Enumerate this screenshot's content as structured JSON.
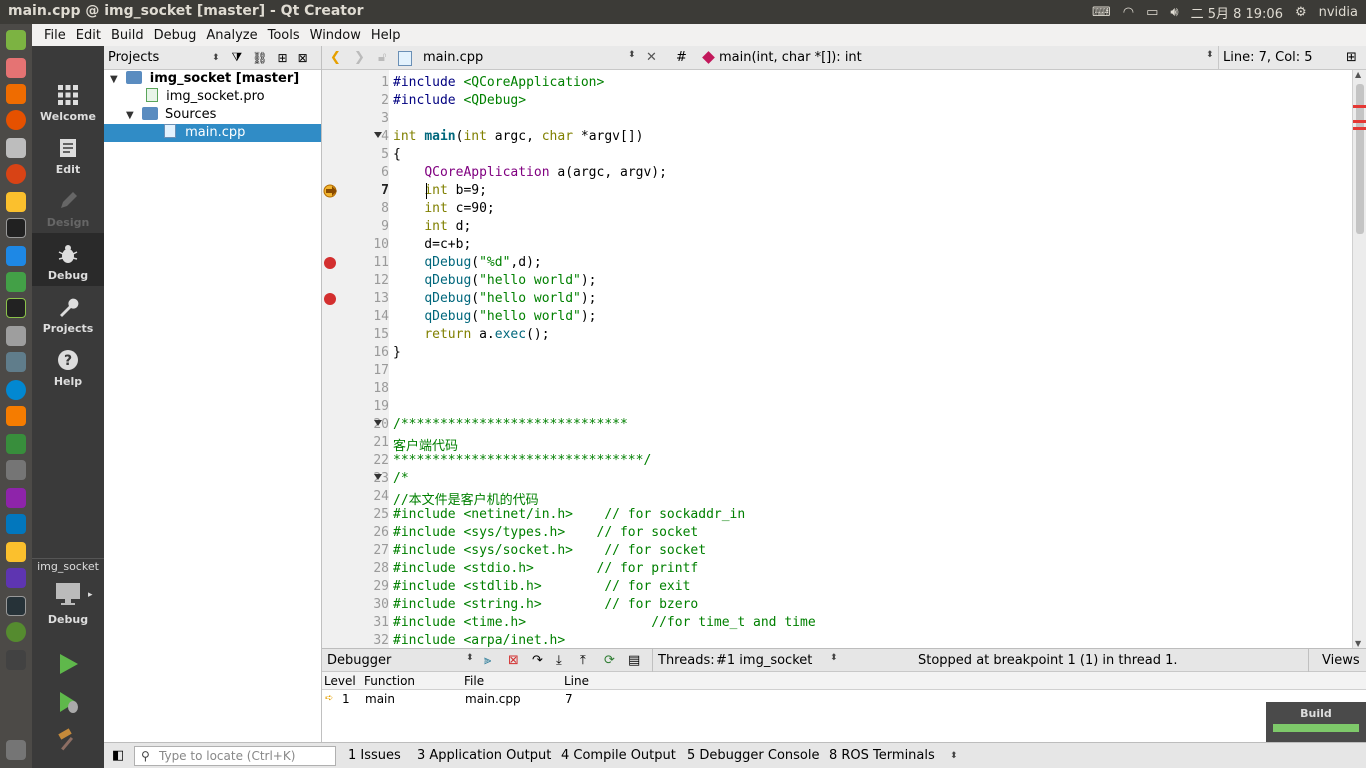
{
  "window": {
    "title": "main.cpp @ img_socket [master] - Qt Creator"
  },
  "top_panel": {
    "clock": "二 5月  8 19:06",
    "user": "nvidia"
  },
  "menubar": [
    "File",
    "Edit",
    "Build",
    "Debug",
    "Analyze",
    "Tools",
    "Window",
    "Help"
  ],
  "modes": [
    {
      "label": "Welcome"
    },
    {
      "label": "Edit"
    },
    {
      "label": "Design"
    },
    {
      "label": "Debug"
    },
    {
      "label": "Projects"
    },
    {
      "label": "Help"
    }
  ],
  "kit": {
    "project": "img_socket",
    "config": "Debug"
  },
  "projects": {
    "header": "Projects",
    "root": "img_socket [master]",
    "pro_file": "img_socket.pro",
    "sources": "Sources",
    "main_file": "main.cpp"
  },
  "editor_toolbar": {
    "file": "main.cpp",
    "hash": "#",
    "symbol": "main(int, char *[]): int",
    "position": "Line: 7, Col: 5"
  },
  "line_numbers": [
    "1",
    "2",
    "3",
    "4",
    "5",
    "6",
    "7",
    "8",
    "9",
    "10",
    "11",
    "12",
    "13",
    "14",
    "15",
    "16",
    "17",
    "18",
    "19",
    "20",
    "21",
    "22",
    "23",
    "24",
    "25",
    "26",
    "27",
    "28",
    "29",
    "30",
    "31",
    "32"
  ],
  "code": {
    "l1a": "#include ",
    "l1b": "<QCoreApplication>",
    "l2a": "#include ",
    "l2b": "<QDebug>",
    "l4a": "int",
    "l4b": "main",
    "l4c": "(",
    "l4d": "int",
    "l4e": " argc, ",
    "l4f": "char",
    "l4g": " *argv[])",
    "l5": "{",
    "l6a": "    ",
    "l6b": "QCoreApplication",
    "l6c": " a(argc, argv);",
    "l7a": "    ",
    "l7b": "int",
    "l7c": " b=9;",
    "l8a": "    ",
    "l8b": "int",
    "l8c": " c=90;",
    "l9a": "    ",
    "l9b": "int",
    "l9c": " d;",
    "l10": "    d=c+b;",
    "l11a": "    ",
    "l11b": "qDebug",
    "l11c": "(",
    "l11d": "\"%d\"",
    "l11e": ",d);",
    "l12a": "    ",
    "l12b": "qDebug",
    "l12c": "(",
    "l12d": "\"hello world\"",
    "l12e": ");",
    "l13a": "    ",
    "l13b": "qDebug",
    "l13c": "(",
    "l13d": "\"hello world\"",
    "l13e": ");",
    "l14a": "    ",
    "l14b": "qDebug",
    "l14c": "(",
    "l14d": "\"hello world\"",
    "l14e": ");",
    "l15a": "    ",
    "l15b": "return",
    "l15c": " a.",
    "l15d": "exec",
    "l15e": "();",
    "l16": "}",
    "l20": "/*****************************",
    "l21": "客户端代码",
    "l22": "********************************/",
    "l23": "/*",
    "l24": "//本文件是客户机的代码",
    "l25": "#include <netinet/in.h>    // for sockaddr_in",
    "l26": "#include <sys/types.h>    // for socket",
    "l27": "#include <sys/socket.h>    // for socket",
    "l28": "#include <stdio.h>        // for printf",
    "l29": "#include <stdlib.h>        // for exit",
    "l30": "#include <string.h>        // for bzero",
    "l31": "#include <time.h>                //for time_t and time",
    "l32": "#include <arpa/inet.h>"
  },
  "debugger": {
    "title": "Debugger",
    "threads_label": "Threads:",
    "thread": "#1 img_socket",
    "status": "Stopped at breakpoint 1 (1) in thread 1.",
    "views": "Views"
  },
  "stack": {
    "headers": [
      "Level",
      "Function",
      "File",
      "Line"
    ],
    "row": {
      "level": "1",
      "function": "main",
      "file": "main.cpp",
      "line": "7"
    }
  },
  "bottom": {
    "locator_placeholder": "Type to locate (Ctrl+K)",
    "tabs": [
      "1  Issues",
      "3  Application Output",
      "4  Compile Output",
      "5  Debugger Console",
      "8  ROS Terminals"
    ]
  },
  "build_box": {
    "label": "Build"
  },
  "colors": {
    "selection": "#308cc6",
    "breakpoint": "#d32f2f",
    "build_progress": "#7ec96a"
  }
}
